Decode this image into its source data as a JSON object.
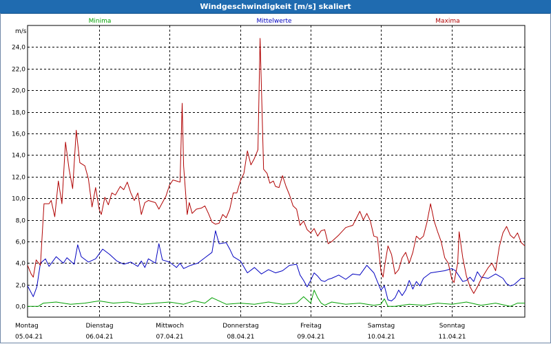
{
  "window": {
    "title": "Windgeschwindigkeit [m/s] skaliert"
  },
  "chart_data": {
    "type": "line",
    "title": "Windgeschwindigkeit [m/s] skaliert",
    "ylabel": "m/s",
    "ylim": [
      -1.0,
      26.0
    ],
    "y_ticks": [
      "0,0",
      "2,0",
      "4,0",
      "6,0",
      "8,0",
      "10,0",
      "12,0",
      "14,0",
      "16,0",
      "18,0",
      "20,0",
      "22,0",
      "24,0"
    ],
    "x_ticks": [
      {
        "day": "Montag",
        "date": "05.04.21"
      },
      {
        "day": "Dienstag",
        "date": "06.04.21"
      },
      {
        "day": "Mittwoch",
        "date": "07.04.21"
      },
      {
        "day": "Donnerstag",
        "date": "08.04.21"
      },
      {
        "day": "Freitag",
        "date": "09.04.21"
      },
      {
        "day": "Samstag",
        "date": "10.04.21"
      },
      {
        "day": "Sonntag",
        "date": "11.04.21"
      }
    ],
    "x_unit": "days since Montag 05.04.21 00:00",
    "xlim": [
      0,
      7
    ],
    "grid": true,
    "series": [
      {
        "name": "Minima",
        "color": "#00a000",
        "points": [
          [
            0,
            0.0
          ],
          [
            0.15,
            0.0
          ],
          [
            0.22,
            0.3
          ],
          [
            0.4,
            0.4
          ],
          [
            0.6,
            0.2
          ],
          [
            0.8,
            0.3
          ],
          [
            1.0,
            0.5
          ],
          [
            1.2,
            0.3
          ],
          [
            1.4,
            0.4
          ],
          [
            1.6,
            0.2
          ],
          [
            1.8,
            0.3
          ],
          [
            2.0,
            0.4
          ],
          [
            2.2,
            0.2
          ],
          [
            2.35,
            0.5
          ],
          [
            2.5,
            0.3
          ],
          [
            2.6,
            0.8
          ],
          [
            2.7,
            0.5
          ],
          [
            2.8,
            0.2
          ],
          [
            3.0,
            0.3
          ],
          [
            3.2,
            0.2
          ],
          [
            3.4,
            0.4
          ],
          [
            3.6,
            0.2
          ],
          [
            3.8,
            0.3
          ],
          [
            3.9,
            0.9
          ],
          [
            4.0,
            0.3
          ],
          [
            4.05,
            1.5
          ],
          [
            4.1,
            0.8
          ],
          [
            4.15,
            0.3
          ],
          [
            4.2,
            0.1
          ],
          [
            4.3,
            0.4
          ],
          [
            4.5,
            0.2
          ],
          [
            4.7,
            0.3
          ],
          [
            4.9,
            0.1
          ],
          [
            5.0,
            0.2
          ],
          [
            5.05,
            0.7
          ],
          [
            5.1,
            0.0
          ],
          [
            5.2,
            0.0
          ],
          [
            5.4,
            0.2
          ],
          [
            5.6,
            0.1
          ],
          [
            5.8,
            0.3
          ],
          [
            6.0,
            0.2
          ],
          [
            6.2,
            0.4
          ],
          [
            6.4,
            0.1
          ],
          [
            6.6,
            0.3
          ],
          [
            6.8,
            0.0
          ],
          [
            6.9,
            0.3
          ],
          [
            7.0,
            0.3
          ]
        ]
      },
      {
        "name": "Mittelwerte",
        "color": "#0000c0",
        "points": [
          [
            0,
            1.9
          ],
          [
            0.08,
            0.9
          ],
          [
            0.13,
            1.8
          ],
          [
            0.18,
            4.0
          ],
          [
            0.25,
            4.4
          ],
          [
            0.3,
            3.7
          ],
          [
            0.4,
            4.6
          ],
          [
            0.5,
            4.0
          ],
          [
            0.55,
            4.5
          ],
          [
            0.65,
            3.9
          ],
          [
            0.7,
            5.7
          ],
          [
            0.75,
            4.6
          ],
          [
            0.85,
            4.1
          ],
          [
            0.95,
            4.4
          ],
          [
            1.05,
            5.3
          ],
          [
            1.15,
            4.8
          ],
          [
            1.25,
            4.2
          ],
          [
            1.35,
            3.9
          ],
          [
            1.45,
            4.1
          ],
          [
            1.55,
            3.7
          ],
          [
            1.6,
            4.2
          ],
          [
            1.65,
            3.6
          ],
          [
            1.7,
            4.4
          ],
          [
            1.8,
            4.0
          ],
          [
            1.85,
            5.8
          ],
          [
            1.9,
            4.3
          ],
          [
            2.0,
            4.1
          ],
          [
            2.1,
            3.6
          ],
          [
            2.15,
            4.0
          ],
          [
            2.2,
            3.5
          ],
          [
            2.3,
            3.8
          ],
          [
            2.4,
            4.0
          ],
          [
            2.5,
            4.5
          ],
          [
            2.6,
            5.0
          ],
          [
            2.65,
            7.0
          ],
          [
            2.7,
            5.8
          ],
          [
            2.8,
            5.9
          ],
          [
            2.85,
            5.3
          ],
          [
            2.9,
            4.6
          ],
          [
            3.0,
            4.2
          ],
          [
            3.1,
            3.1
          ],
          [
            3.2,
            3.6
          ],
          [
            3.3,
            3.0
          ],
          [
            3.4,
            3.4
          ],
          [
            3.5,
            3.1
          ],
          [
            3.6,
            3.3
          ],
          [
            3.7,
            3.8
          ],
          [
            3.8,
            3.9
          ],
          [
            3.85,
            2.9
          ],
          [
            3.9,
            2.4
          ],
          [
            3.95,
            1.8
          ],
          [
            4.0,
            2.4
          ],
          [
            4.05,
            3.1
          ],
          [
            4.1,
            2.8
          ],
          [
            4.15,
            2.4
          ],
          [
            4.2,
            2.3
          ],
          [
            4.25,
            2.5
          ],
          [
            4.3,
            2.6
          ],
          [
            4.4,
            2.9
          ],
          [
            4.5,
            2.5
          ],
          [
            4.6,
            3.0
          ],
          [
            4.7,
            2.9
          ],
          [
            4.8,
            3.8
          ],
          [
            4.9,
            3.1
          ],
          [
            5.0,
            1.5
          ],
          [
            5.05,
            1.9
          ],
          [
            5.1,
            0.6
          ],
          [
            5.15,
            0.5
          ],
          [
            5.2,
            0.8
          ],
          [
            5.25,
            1.5
          ],
          [
            5.3,
            1.0
          ],
          [
            5.35,
            1.5
          ],
          [
            5.4,
            2.4
          ],
          [
            5.45,
            1.6
          ],
          [
            5.5,
            2.3
          ],
          [
            5.55,
            1.9
          ],
          [
            5.6,
            2.6
          ],
          [
            5.7,
            3.1
          ],
          [
            5.8,
            3.2
          ],
          [
            5.9,
            3.3
          ],
          [
            6.0,
            3.5
          ],
          [
            6.05,
            3.3
          ],
          [
            6.1,
            2.8
          ],
          [
            6.15,
            2.3
          ],
          [
            6.2,
            2.4
          ],
          [
            6.25,
            2.7
          ],
          [
            6.3,
            2.3
          ],
          [
            6.35,
            3.2
          ],
          [
            6.4,
            2.7
          ],
          [
            6.5,
            2.6
          ],
          [
            6.6,
            3.0
          ],
          [
            6.65,
            2.8
          ],
          [
            6.7,
            2.6
          ],
          [
            6.75,
            2.1
          ],
          [
            6.8,
            1.9
          ],
          [
            6.85,
            2.0
          ],
          [
            6.9,
            2.3
          ],
          [
            6.95,
            2.6
          ],
          [
            7.0,
            2.6
          ]
        ]
      },
      {
        "name": "Maxima",
        "color": "#b00000",
        "points": [
          [
            0,
            3.8
          ],
          [
            0.05,
            3.0
          ],
          [
            0.08,
            2.7
          ],
          [
            0.12,
            4.3
          ],
          [
            0.18,
            3.8
          ],
          [
            0.23,
            9.5
          ],
          [
            0.3,
            9.5
          ],
          [
            0.33,
            9.8
          ],
          [
            0.38,
            8.3
          ],
          [
            0.43,
            11.6
          ],
          [
            0.48,
            9.5
          ],
          [
            0.53,
            15.2
          ],
          [
            0.58,
            12.7
          ],
          [
            0.63,
            10.9
          ],
          [
            0.68,
            16.3
          ],
          [
            0.73,
            13.3
          ],
          [
            0.8,
            13.0
          ],
          [
            0.85,
            11.8
          ],
          [
            0.9,
            9.2
          ],
          [
            0.95,
            11.0
          ],
          [
            1.0,
            9.0
          ],
          [
            1.03,
            8.5
          ],
          [
            1.08,
            10.1
          ],
          [
            1.13,
            9.4
          ],
          [
            1.18,
            10.5
          ],
          [
            1.23,
            10.3
          ],
          [
            1.3,
            11.1
          ],
          [
            1.35,
            10.8
          ],
          [
            1.4,
            11.5
          ],
          [
            1.45,
            10.5
          ],
          [
            1.5,
            9.8
          ],
          [
            1.55,
            10.5
          ],
          [
            1.6,
            8.5
          ],
          [
            1.65,
            9.6
          ],
          [
            1.7,
            9.8
          ],
          [
            1.8,
            9.6
          ],
          [
            1.85,
            9.0
          ],
          [
            1.9,
            9.6
          ],
          [
            1.95,
            10.2
          ],
          [
            2.0,
            11.2
          ],
          [
            2.05,
            11.7
          ],
          [
            2.1,
            11.6
          ],
          [
            2.15,
            11.5
          ],
          [
            2.18,
            18.8
          ],
          [
            2.2,
            13.0
          ],
          [
            2.25,
            8.5
          ],
          [
            2.28,
            9.6
          ],
          [
            2.32,
            8.6
          ],
          [
            2.38,
            9.0
          ],
          [
            2.45,
            9.1
          ],
          [
            2.5,
            9.3
          ],
          [
            2.55,
            8.6
          ],
          [
            2.6,
            7.8
          ],
          [
            2.65,
            7.6
          ],
          [
            2.7,
            7.7
          ],
          [
            2.75,
            8.5
          ],
          [
            2.8,
            8.2
          ],
          [
            2.85,
            9.0
          ],
          [
            2.9,
            10.5
          ],
          [
            2.95,
            10.5
          ],
          [
            3.0,
            11.6
          ],
          [
            3.05,
            12.3
          ],
          [
            3.1,
            14.4
          ],
          [
            3.15,
            13.1
          ],
          [
            3.2,
            13.7
          ],
          [
            3.25,
            14.5
          ],
          [
            3.28,
            24.8
          ],
          [
            3.3,
            20.2
          ],
          [
            3.33,
            12.7
          ],
          [
            3.38,
            12.3
          ],
          [
            3.42,
            11.4
          ],
          [
            3.47,
            11.6
          ],
          [
            3.5,
            11.1
          ],
          [
            3.55,
            11.0
          ],
          [
            3.6,
            12.1
          ],
          [
            3.65,
            11.1
          ],
          [
            3.7,
            10.3
          ],
          [
            3.75,
            9.3
          ],
          [
            3.8,
            9.0
          ],
          [
            3.85,
            7.5
          ],
          [
            3.9,
            7.9
          ],
          [
            3.95,
            7.1
          ],
          [
            4.0,
            6.8
          ],
          [
            4.05,
            7.2
          ],
          [
            4.1,
            6.5
          ],
          [
            4.15,
            7.0
          ],
          [
            4.2,
            7.1
          ],
          [
            4.25,
            5.8
          ],
          [
            4.3,
            6.0
          ],
          [
            4.4,
            6.6
          ],
          [
            4.5,
            7.3
          ],
          [
            4.6,
            7.5
          ],
          [
            4.7,
            8.8
          ],
          [
            4.75,
            8.0
          ],
          [
            4.8,
            8.6
          ],
          [
            4.85,
            7.9
          ],
          [
            4.9,
            6.5
          ],
          [
            4.95,
            6.4
          ],
          [
            5.0,
            3.3
          ],
          [
            5.03,
            2.7
          ],
          [
            5.05,
            3.6
          ],
          [
            5.1,
            5.6
          ],
          [
            5.15,
            4.8
          ],
          [
            5.2,
            3.0
          ],
          [
            5.25,
            3.4
          ],
          [
            5.3,
            4.5
          ],
          [
            5.35,
            5.0
          ],
          [
            5.4,
            4.0
          ],
          [
            5.45,
            5.0
          ],
          [
            5.5,
            6.5
          ],
          [
            5.55,
            6.2
          ],
          [
            5.6,
            6.5
          ],
          [
            5.65,
            7.8
          ],
          [
            5.7,
            9.5
          ],
          [
            5.75,
            7.9
          ],
          [
            5.8,
            6.9
          ],
          [
            5.85,
            6.0
          ],
          [
            5.9,
            4.5
          ],
          [
            5.95,
            4.0
          ],
          [
            6.0,
            2.5
          ],
          [
            6.03,
            2.2
          ],
          [
            6.08,
            4.0
          ],
          [
            6.1,
            6.9
          ],
          [
            6.15,
            4.5
          ],
          [
            6.2,
            2.8
          ],
          [
            6.25,
            1.8
          ],
          [
            6.3,
            1.2
          ],
          [
            6.35,
            1.8
          ],
          [
            6.4,
            2.5
          ],
          [
            6.5,
            3.6
          ],
          [
            6.55,
            4.0
          ],
          [
            6.6,
            3.3
          ],
          [
            6.65,
            5.5
          ],
          [
            6.7,
            6.8
          ],
          [
            6.75,
            7.4
          ],
          [
            6.8,
            6.6
          ],
          [
            6.85,
            6.3
          ],
          [
            6.9,
            6.8
          ],
          [
            6.95,
            5.9
          ],
          [
            7.0,
            5.6
          ]
        ]
      }
    ]
  }
}
